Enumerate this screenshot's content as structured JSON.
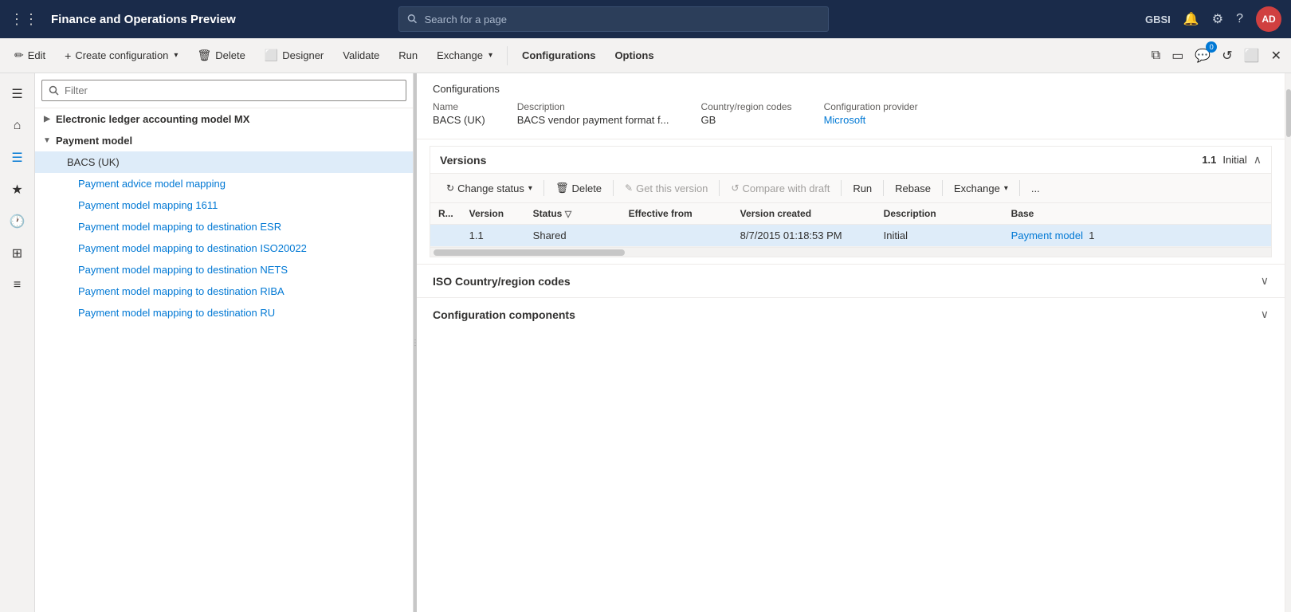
{
  "app": {
    "title": "Finance and Operations Preview",
    "search_placeholder": "Search for a page",
    "user_initials": "AD",
    "user_region": "GBSI"
  },
  "toolbar": {
    "edit": "Edit",
    "create_config": "Create configuration",
    "delete": "Delete",
    "designer": "Designer",
    "validate": "Validate",
    "run": "Run",
    "exchange": "Exchange",
    "configurations": "Configurations",
    "options": "Options"
  },
  "tree": {
    "filter_placeholder": "Filter",
    "items": [
      {
        "label": "Electronic ledger accounting model MX",
        "level": 0,
        "expandable": true,
        "expanded": false
      },
      {
        "label": "Payment model",
        "level": 0,
        "expandable": true,
        "expanded": true
      },
      {
        "label": "BACS (UK)",
        "level": 1,
        "selected": true
      },
      {
        "label": "Payment advice model mapping",
        "level": 2
      },
      {
        "label": "Payment model mapping 1611",
        "level": 2
      },
      {
        "label": "Payment model mapping to destination ESR",
        "level": 2
      },
      {
        "label": "Payment model mapping to destination ISO20022",
        "level": 2
      },
      {
        "label": "Payment model mapping to destination NETS",
        "level": 2
      },
      {
        "label": "Payment model mapping to destination RIBA",
        "level": 2
      },
      {
        "label": "Payment model mapping to destination RU",
        "level": 2
      }
    ]
  },
  "config_details": {
    "breadcrumb": "Configurations",
    "name_label": "Name",
    "name_value": "BACS (UK)",
    "description_label": "Description",
    "description_value": "BACS vendor payment format f...",
    "country_label": "Country/region codes",
    "country_value": "GB",
    "provider_label": "Configuration provider",
    "provider_value": "Microsoft"
  },
  "versions": {
    "section_title": "Versions",
    "version_badge": "1.1",
    "status_badge": "Initial",
    "toolbar": {
      "change_status": "Change status",
      "delete": "Delete",
      "get_this_version": "Get this version",
      "compare_with_draft": "Compare with draft",
      "run": "Run",
      "rebase": "Rebase",
      "exchange": "Exchange",
      "more": "..."
    },
    "columns": {
      "r": "R...",
      "version": "Version",
      "status": "Status",
      "effective_from": "Effective from",
      "version_created": "Version created",
      "description": "Description",
      "base": "Base"
    },
    "rows": [
      {
        "r": "",
        "version": "1.1",
        "status": "Shared",
        "effective_from": "",
        "version_created": "8/7/2015 01:18:53 PM",
        "description": "Initial",
        "base": "Payment model",
        "base_num": "1"
      }
    ]
  },
  "iso_section": {
    "title": "ISO Country/region codes"
  },
  "config_components": {
    "title": "Configuration components"
  }
}
